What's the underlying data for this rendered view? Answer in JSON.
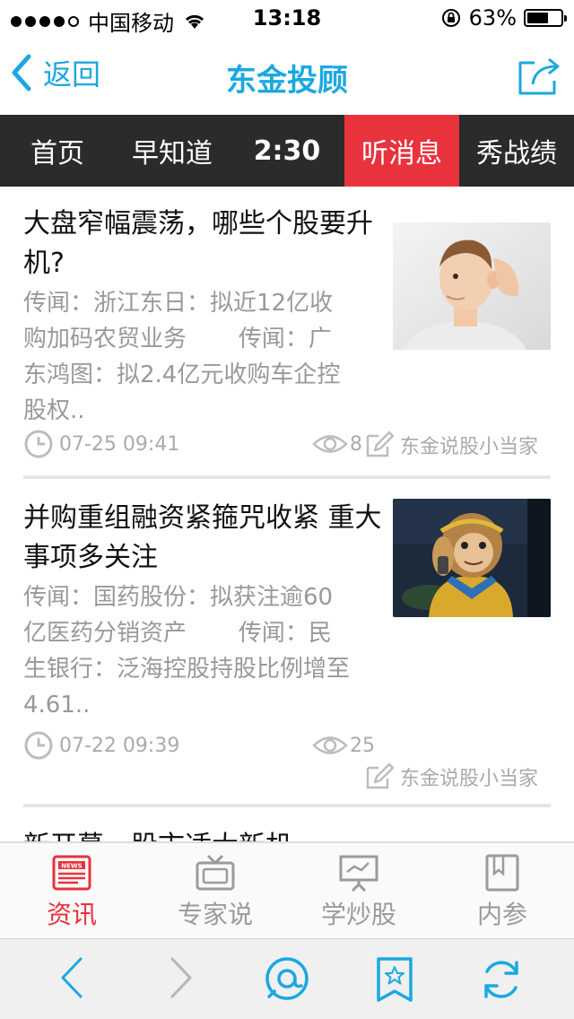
{
  "status_bar": {
    "carrier": "中国移动",
    "time": "13:18",
    "battery": "63%",
    "battery_level": 0.63,
    "icons": [
      "signal-dots",
      "wifi-icon",
      "rotation-lock-icon",
      "battery-icon"
    ]
  },
  "nav": {
    "back_label": "返回",
    "title": "东金投顾",
    "share_icon": "share-icon"
  },
  "tabs": [
    {
      "label": "首页"
    },
    {
      "label": "早知道"
    },
    {
      "label": "2:30"
    },
    {
      "label": "听消息",
      "active": true
    },
    {
      "label": "秀战绩"
    }
  ],
  "articles": [
    {
      "title": "大盘窄幅震荡，哪些个股要升机?",
      "summary_lines": [
        "传闻：浙江东日：拟近12亿收",
        "购加码农贸业务       传闻：广",
        "东鸿图：拟2.4亿元收购车企控",
        "股权.."
      ],
      "datetime": "07-25 09:41",
      "views": "8",
      "author": "东金说股小当家",
      "thumb": "boy-listening-photo"
    },
    {
      "title": "并购重组融资紧箍咒收紧 重大事项多关注",
      "summary_lines": [
        "传闻：国药股份：拟获注逾60",
        "亿医药分销资产       传闻：民",
        "生银行：泛海控股持股比例增至",
        "4.61.."
      ],
      "datetime": "07-22 09:39",
      "views": "25",
      "author": "东金说股小当家",
      "thumb": "monkey-cartoon-image"
    },
    {
      "title_partial": "新开募…股市适大新机"
    }
  ],
  "tab_bar": [
    {
      "label": "资讯",
      "icon": "news-icon",
      "active": true
    },
    {
      "label": "专家说",
      "icon": "tv-icon"
    },
    {
      "label": "学炒股",
      "icon": "presentation-board-icon"
    },
    {
      "label": "内参",
      "icon": "notebook-icon"
    }
  ],
  "browser_toolbar": {
    "icons": [
      "back-arrow-icon",
      "forward-arrow-icon",
      "chat-bubble-icon",
      "bookmark-star-icon",
      "refresh-icon"
    ]
  },
  "colors": {
    "accent_blue": "#1ba8e0",
    "active_red": "#e8323c",
    "tab_strip_bg": "#2b2b2b"
  }
}
